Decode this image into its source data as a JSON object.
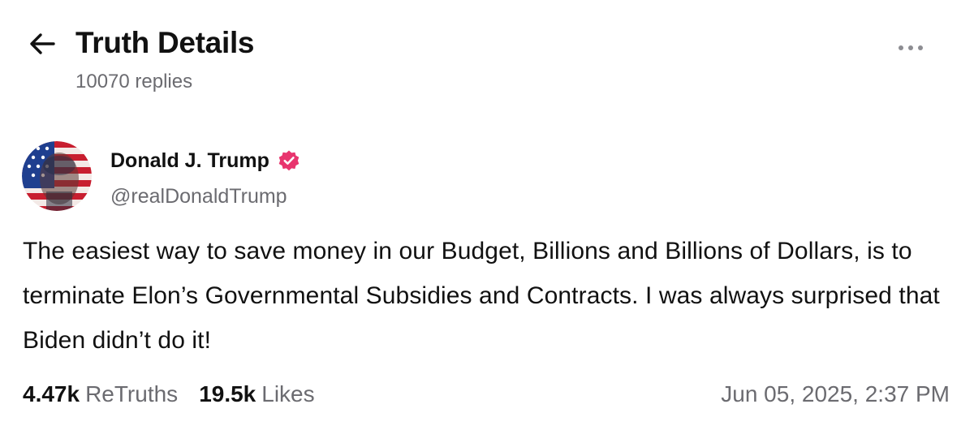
{
  "header": {
    "title": "Truth Details",
    "reply_count": "10070 replies"
  },
  "post": {
    "author": {
      "name": "Donald J. Trump",
      "handle": "@realDonaldTrump",
      "verified": true
    },
    "text": "The easiest way to save money in our Budget, Billions and Billions of Dollars, is to terminate Elon’s Governmental Subsidies and Contracts. I was always surprised that Biden didn’t do it!",
    "stats": {
      "retruths_count": "4.47k",
      "retruths_label": "ReTruths",
      "likes_count": "19.5k",
      "likes_label": "Likes"
    },
    "timestamp": "Jun 05, 2025, 2:37 PM"
  },
  "icons": {
    "back": "arrow-left-icon",
    "more": "ellipsis-icon",
    "verified": "verified-badge-icon"
  },
  "colors": {
    "text_primary": "#111111",
    "text_secondary": "#6b6b70",
    "verified_badge": "#e8356e",
    "background": "#ffffff"
  }
}
